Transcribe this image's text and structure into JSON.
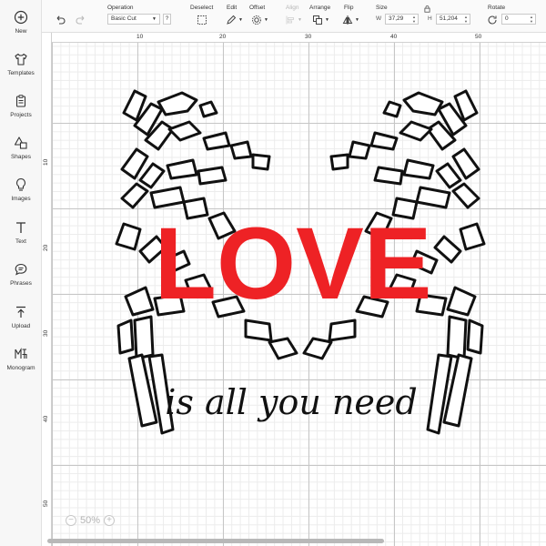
{
  "sidebar": {
    "items": [
      {
        "label": "New",
        "icon": "plus-circle-icon"
      },
      {
        "label": "Templates",
        "icon": "shirt-icon"
      },
      {
        "label": "Projects",
        "icon": "clipboard-icon"
      },
      {
        "label": "Shapes",
        "icon": "shapes-icon"
      },
      {
        "label": "Images",
        "icon": "bulb-icon"
      },
      {
        "label": "Text",
        "icon": "text-icon"
      },
      {
        "label": "Phrases",
        "icon": "speech-bubble-icon"
      },
      {
        "label": "Upload",
        "icon": "upload-icon"
      },
      {
        "label": "Monogram",
        "icon": "monogram-icon"
      }
    ]
  },
  "toolbar": {
    "operation_label": "Operation",
    "operation_value": "Basic Cut",
    "help": "?",
    "deselect_label": "Deselect",
    "edit_label": "Edit",
    "offset_label": "Offset",
    "align_label": "Align",
    "arrange_label": "Arrange",
    "flip_label": "Flip",
    "size_label": "Size",
    "width_letter": "W",
    "width_value": "37,29",
    "height_letter": "H",
    "height_value": "51,204",
    "rotate_label": "Rotate",
    "rotate_value": "0"
  },
  "ruler": {
    "top": [
      "10",
      "20",
      "30",
      "40",
      "50"
    ],
    "left": [
      "10",
      "20",
      "30",
      "40",
      "50"
    ]
  },
  "artwork": {
    "word": "LOVE",
    "script_text": "is all you need",
    "word_color": "#ee2225"
  },
  "zoom": {
    "value": "50%",
    "minus": "−",
    "plus": "+"
  }
}
